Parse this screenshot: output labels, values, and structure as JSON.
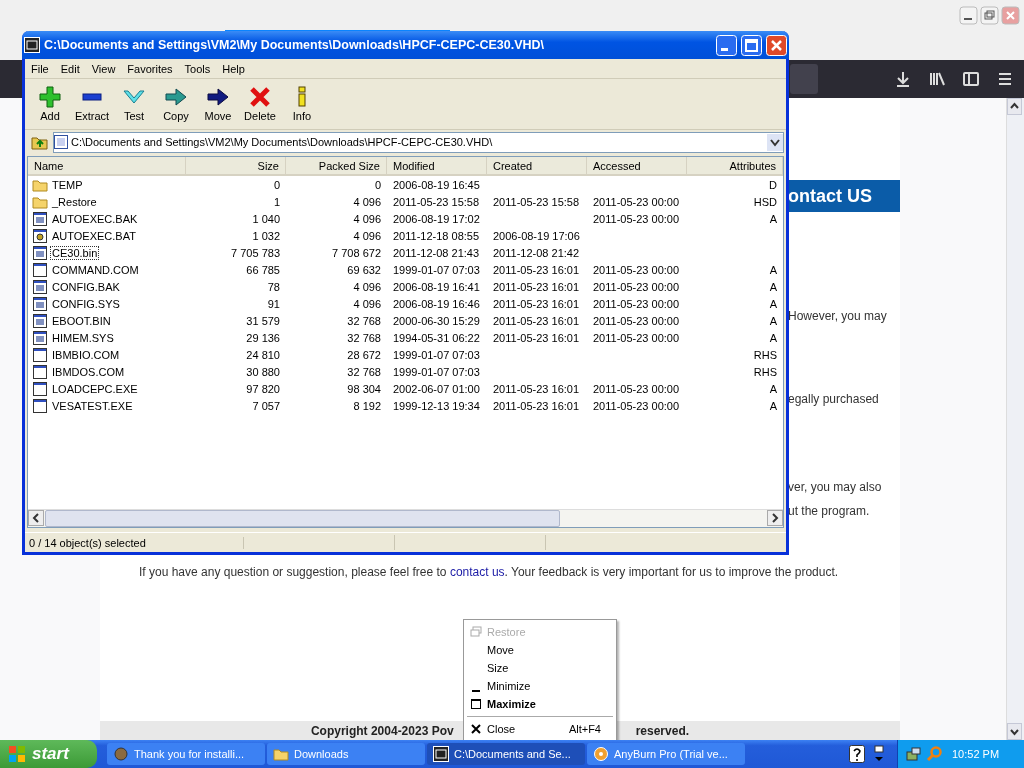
{
  "browser": {
    "heading": "ontact US",
    "fragments": [
      "However, you may",
      "egally purchased",
      "ver, you may also",
      "ut the program."
    ],
    "feedback": {
      "before": "If you have any question or suggestion, please feel free to ",
      "link": "contact us",
      "after": ". Your feedback is very important for us to improve the product."
    },
    "footer_left": "Copyright 2004-2023 Pov",
    "footer_right": "reserved."
  },
  "window": {
    "title": "C:\\Documents and Settings\\VM2\\My Documents\\Downloads\\HPCF-CEPC-CE30.VHD\\",
    "menu": [
      "File",
      "Edit",
      "View",
      "Favorites",
      "Tools",
      "Help"
    ],
    "toolbar": [
      {
        "label": "Add",
        "kind": "add"
      },
      {
        "label": "Extract",
        "kind": "extract"
      },
      {
        "label": "Test",
        "kind": "test"
      },
      {
        "label": "Copy",
        "kind": "copy"
      },
      {
        "label": "Move",
        "kind": "move"
      },
      {
        "label": "Delete",
        "kind": "delete"
      },
      {
        "label": "Info",
        "kind": "info"
      }
    ],
    "address": "C:\\Documents and Settings\\VM2\\My Documents\\Downloads\\HPCF-CEPC-CE30.VHD\\",
    "columns": [
      "Name",
      "Size",
      "Packed Size",
      "Modified",
      "Created",
      "Accessed",
      "Attributes"
    ],
    "rows": [
      {
        "kind": "folder",
        "name": "TEMP",
        "size": "0",
        "packed": "0",
        "modified": "2006-08-19 16:45",
        "attributes": "D",
        "focused": false
      },
      {
        "kind": "folder",
        "name": "_Restore",
        "size": "1",
        "packed": "4 096",
        "modified": "2011-05-23 15:58",
        "created": "2011-05-23 15:58",
        "accessed": "2011-05-23 00:00",
        "attributes": "HSD",
        "focused": false
      },
      {
        "kind": "doc",
        "name": "AUTOEXEC.BAK",
        "size": "1 040",
        "packed": "4 096",
        "modified": "2006-08-19 17:02",
        "accessed": "2011-05-23 00:00",
        "attributes": "A",
        "focused": false
      },
      {
        "kind": "batch",
        "name": "AUTOEXEC.BAT",
        "size": "1 032",
        "packed": "4 096",
        "modified": "2011-12-18 08:55",
        "created": "2006-08-19 17:06",
        "focused": false
      },
      {
        "kind": "doc",
        "name": "CE30.bin",
        "size": "7 705 783",
        "packed": "7 708 672",
        "modified": "2011-12-08 21:43",
        "created": "2011-12-08 21:42",
        "focused": true
      },
      {
        "kind": "program",
        "name": "COMMAND.COM",
        "size": "66 785",
        "packed": "69 632",
        "modified": "1999-01-07 07:03",
        "created": "2011-05-23 16:01",
        "accessed": "2011-05-23 00:00",
        "attributes": "A",
        "focused": false
      },
      {
        "kind": "doc",
        "name": "CONFIG.BAK",
        "size": "78",
        "packed": "4 096",
        "modified": "2006-08-19 16:41",
        "created": "2011-05-23 16:01",
        "accessed": "2011-05-23 00:00",
        "attributes": "A",
        "focused": false
      },
      {
        "kind": "doc",
        "name": "CONFIG.SYS",
        "size": "91",
        "packed": "4 096",
        "modified": "2006-08-19 16:46",
        "created": "2011-05-23 16:01",
        "accessed": "2011-05-23 00:00",
        "attributes": "A",
        "focused": false
      },
      {
        "kind": "doc",
        "name": "EBOOT.BIN",
        "size": "31 579",
        "packed": "32 768",
        "modified": "2000-06-30 15:29",
        "created": "2011-05-23 16:01",
        "accessed": "2011-05-23 00:00",
        "attributes": "A",
        "focused": false
      },
      {
        "kind": "doc",
        "name": "HIMEM.SYS",
        "size": "29 136",
        "packed": "32 768",
        "modified": "1994-05-31 06:22",
        "created": "2011-05-23 16:01",
        "accessed": "2011-05-23 00:00",
        "attributes": "A",
        "focused": false
      },
      {
        "kind": "program",
        "name": "IBMBIO.COM",
        "size": "24 810",
        "packed": "28 672",
        "modified": "1999-01-07 07:03",
        "attributes": "RHS",
        "focused": false
      },
      {
        "kind": "program",
        "name": "IBMDOS.COM",
        "size": "30 880",
        "packed": "32 768",
        "modified": "1999-01-07 07:03",
        "attributes": "RHS",
        "focused": false
      },
      {
        "kind": "program",
        "name": "LOADCEPC.EXE",
        "size": "97 820",
        "packed": "98 304",
        "modified": "2002-06-07 01:00",
        "created": "2011-05-23 16:01",
        "accessed": "2011-05-23 00:00",
        "attributes": "A",
        "focused": false
      },
      {
        "kind": "program",
        "name": "VESATEST.EXE",
        "size": "7 057",
        "packed": "8 192",
        "modified": "1999-12-13 19:34",
        "created": "2011-05-23 16:01",
        "accessed": "2011-05-23 00:00",
        "attributes": "A",
        "focused": false
      }
    ],
    "status": "0 / 14 object(s) selected"
  },
  "context_menu": [
    {
      "kind": "restore",
      "label": "Restore",
      "disabled": true,
      "default": false
    },
    {
      "kind": "move",
      "label": "Move",
      "disabled": false,
      "default": false
    },
    {
      "kind": "size",
      "label": "Size",
      "disabled": false,
      "default": false
    },
    {
      "kind": "minimize",
      "label": "Minimize",
      "disabled": false,
      "default": false
    },
    {
      "kind": "maximize",
      "label": "Maximize",
      "disabled": false,
      "default": true
    },
    {
      "kind": "separator"
    },
    {
      "kind": "close",
      "label": "Close",
      "shortcut": "Alt+F4",
      "disabled": false,
      "default": false
    }
  ],
  "taskbar": {
    "start": "start",
    "tasks": [
      {
        "kind": "browser",
        "label": "Thank you for installi...",
        "selected": false
      },
      {
        "kind": "folder",
        "label": "Downloads",
        "selected": false
      },
      {
        "kind": "archive",
        "label": "C:\\Documents and Se...",
        "selected": true
      },
      {
        "kind": "burn",
        "label": "AnyBurn Pro (Trial ve...",
        "selected": false
      }
    ],
    "clock": "10:52 PM"
  }
}
